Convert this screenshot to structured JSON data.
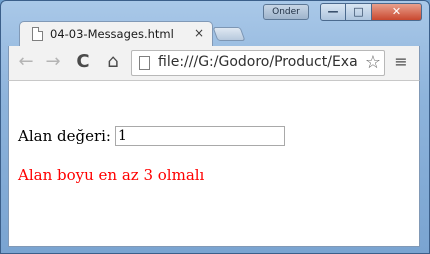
{
  "window": {
    "user_badge": "Onder",
    "min_glyph": "—",
    "max_glyph": "□",
    "close_glyph": "✕"
  },
  "tab": {
    "title": "04-03-Messages.html",
    "close": "×"
  },
  "toolbar": {
    "back": "←",
    "forward": "→",
    "reload": "C",
    "home": "⌂",
    "url": "file:///G:/Godoro/Product/Exa",
    "star": "☆",
    "menu": "≡"
  },
  "page": {
    "field_label": "Alan değeri:",
    "field_value": "1",
    "error_message": "Alan boyu en az 3 olmalı"
  },
  "colors": {
    "error": "#ff0000",
    "window_frame": "#8db3db"
  }
}
